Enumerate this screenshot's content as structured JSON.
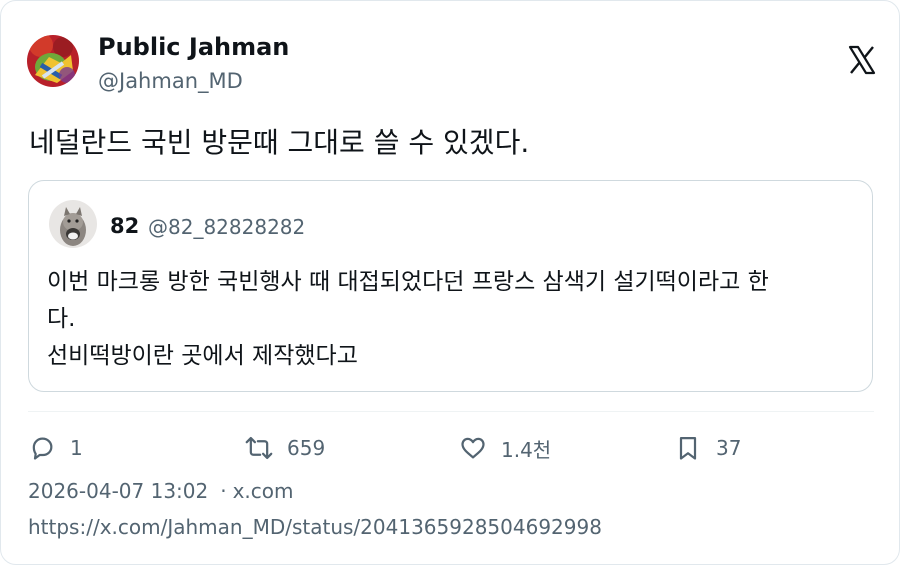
{
  "author": {
    "display_name": "Public Jahman",
    "handle": "@Jahman_MD"
  },
  "logo_icon": "x-logo-icon",
  "tweet": {
    "text": "네덜란드 국빈 방문때 그대로 쓸 수 있겠다."
  },
  "quoted": {
    "name": "82",
    "handle": "@82_82828282",
    "lines": [
      "이번 마크롱 방한 국빈행사 때 대접되었다던 프랑스 삼색기 설기떡이라고 한",
      "다.",
      "선비떡방이란 곳에서 제작했다고"
    ]
  },
  "actions": {
    "replies": "1",
    "retweets": "659",
    "likes": "1.4천",
    "bookmarks": "37"
  },
  "meta": {
    "timestamp": "2026-04-07 13:02",
    "separator": "·",
    "source": "x.com",
    "url": "https://x.com/Jahman_MD/status/2041365928504692998"
  },
  "colors": {
    "text_primary": "#0f1419",
    "text_secondary": "#536471",
    "border": "#cfd9de"
  }
}
